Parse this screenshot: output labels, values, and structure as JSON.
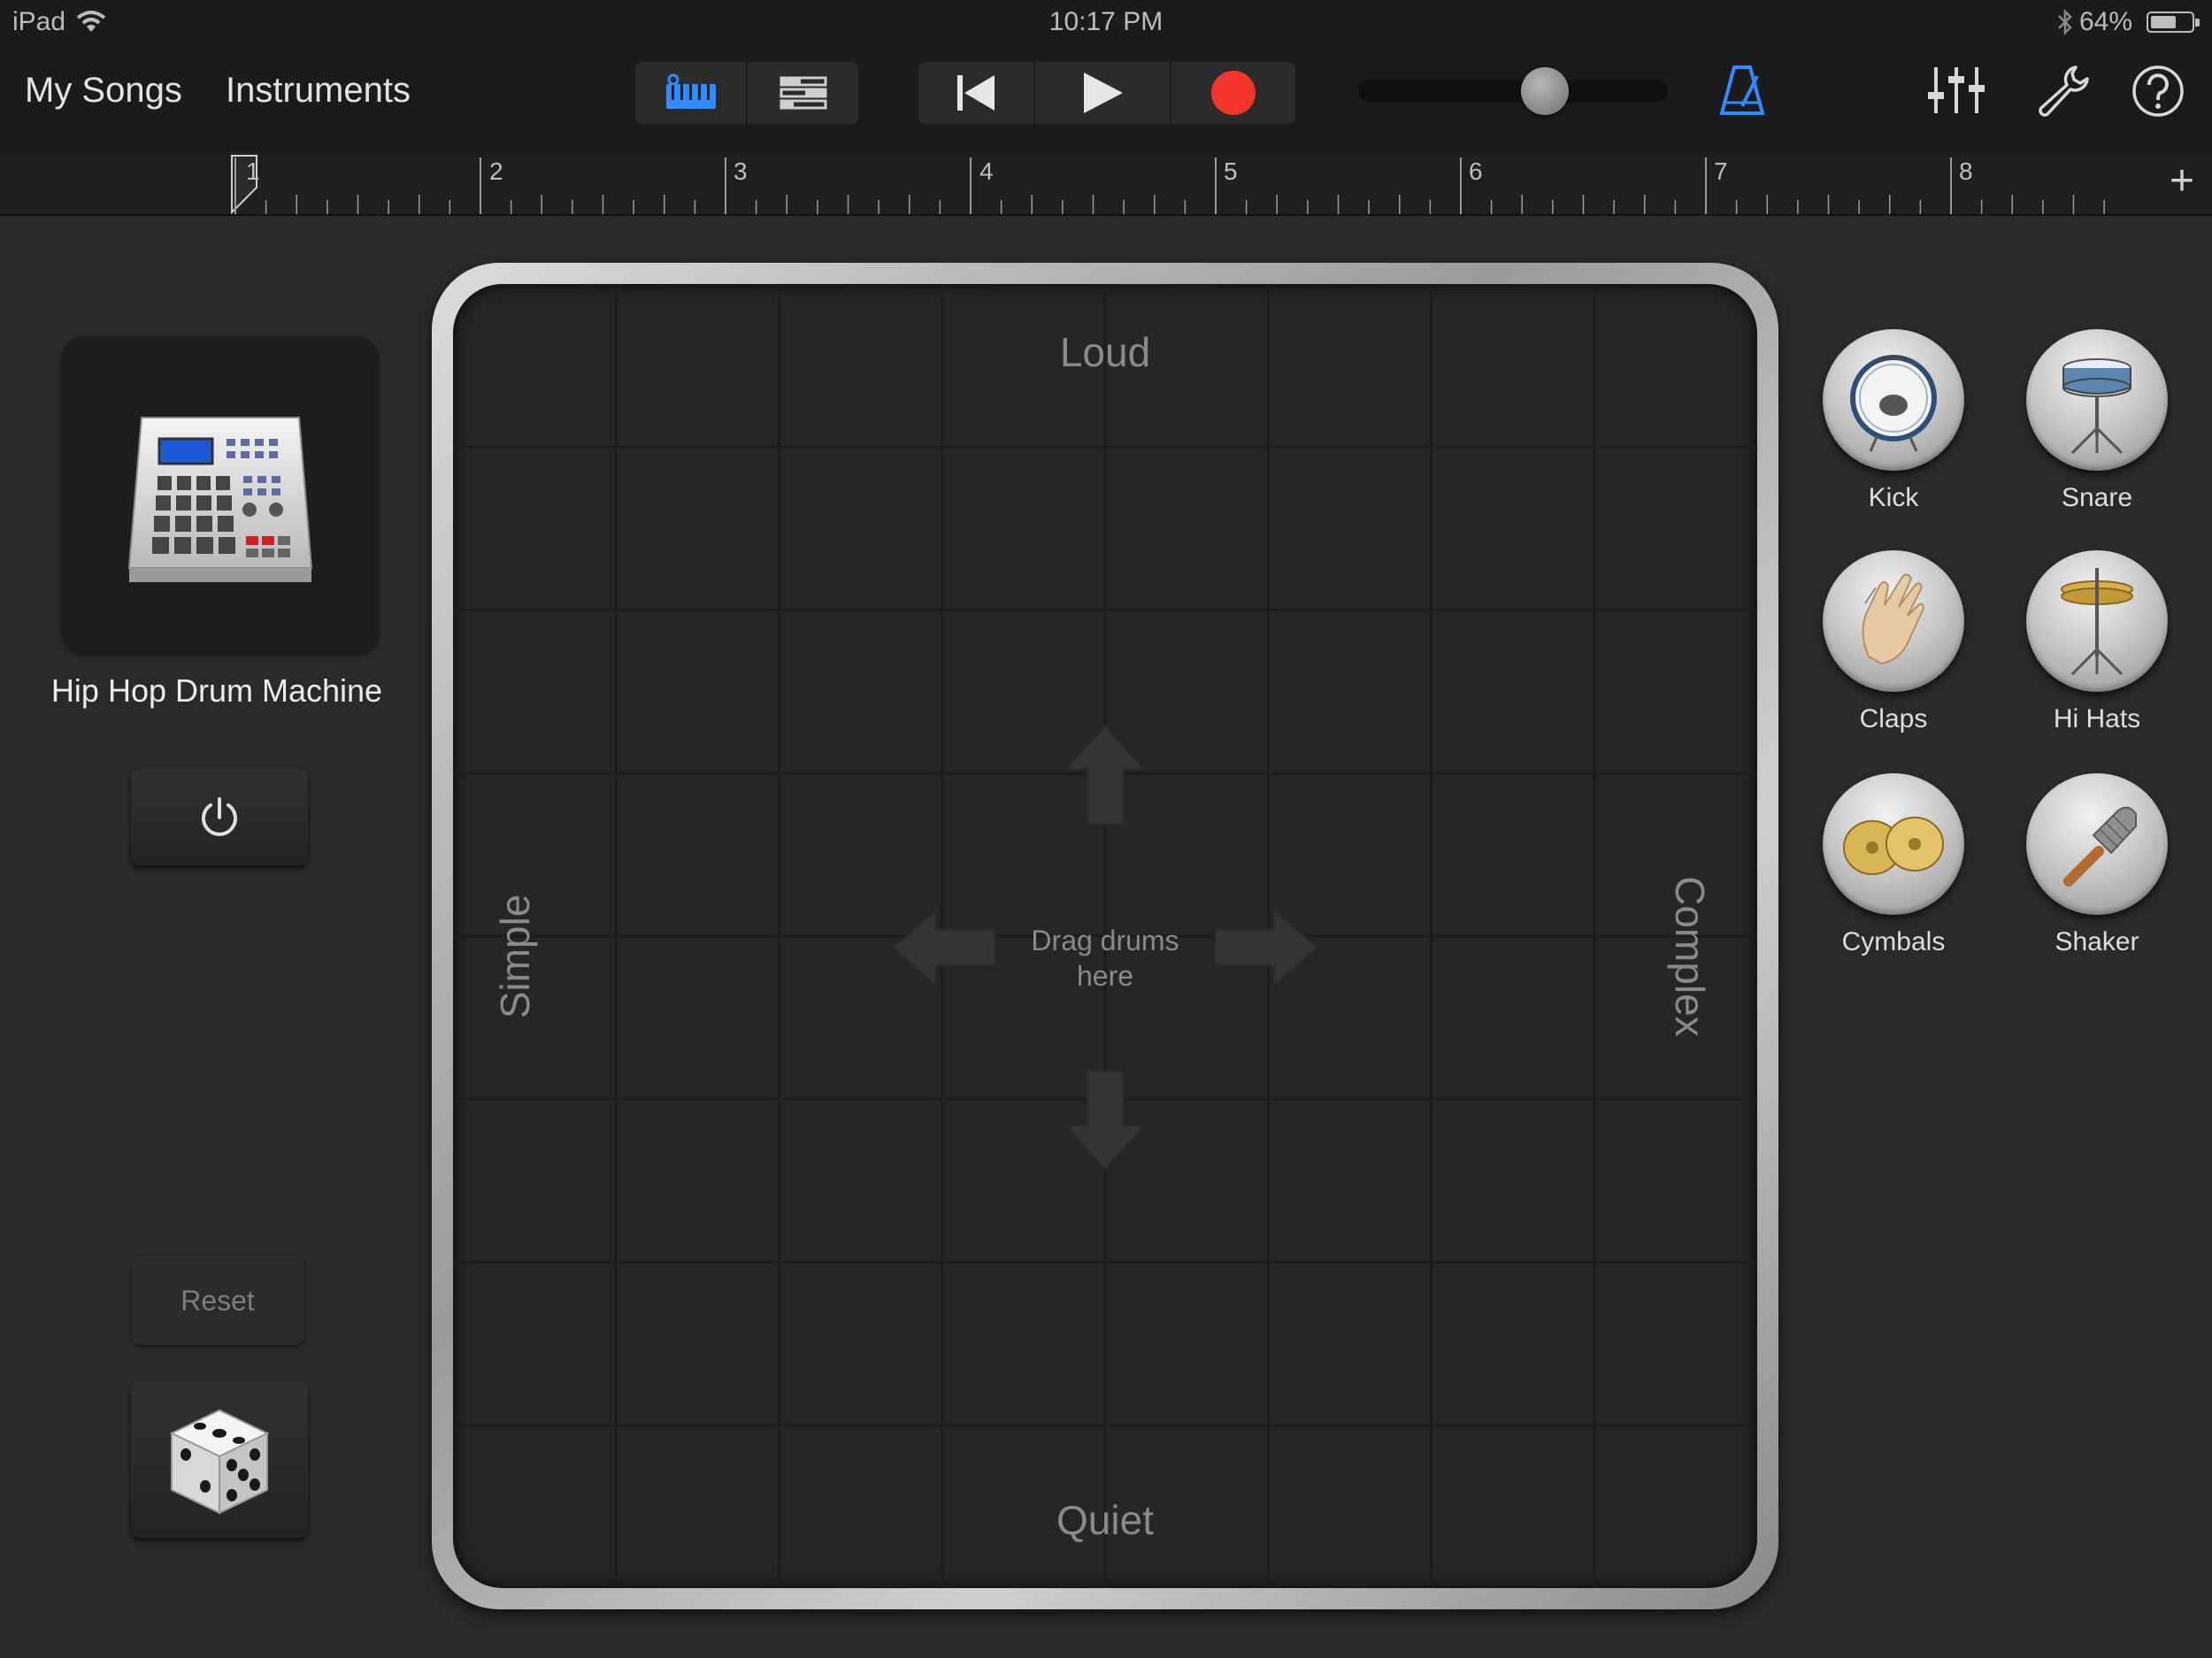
{
  "status_bar": {
    "device": "iPad",
    "time": "10:17 PM",
    "battery_percent": "64%",
    "battery_level": 0.64
  },
  "toolbar": {
    "my_songs": "My Songs",
    "instruments": "Instruments",
    "view_modes": [
      "instrument-view-icon",
      "tracks-view-icon"
    ],
    "active_view": "instrument-view-icon",
    "transport": [
      "go-to-beginning-icon",
      "play-icon",
      "record-icon"
    ],
    "volume_level": 0.62,
    "tools": [
      "metronome-icon",
      "mixer-icon",
      "settings-wrench-icon",
      "help-icon"
    ],
    "accent_color": "#2f8cff",
    "record_color": "#f2342a"
  },
  "ruler": {
    "bars": [
      "1",
      "2",
      "3",
      "4",
      "5",
      "6",
      "7",
      "8"
    ],
    "add_label": "+"
  },
  "instrument": {
    "name": "Hip Hop Drum Machine",
    "icon": "drum-machine-icon",
    "power_icon": "power-icon"
  },
  "controls": {
    "reset_label": "Reset",
    "random_icon": "dice-icon"
  },
  "pad": {
    "top_label": "Loud",
    "bottom_label": "Quiet",
    "left_label": "Simple",
    "right_label": "Complex",
    "hint_line1": "Drag drums",
    "hint_line2": "here"
  },
  "drums": [
    {
      "label": "Kick",
      "icon": "kick-drum-icon"
    },
    {
      "label": "Snare",
      "icon": "snare-drum-icon"
    },
    {
      "label": "Claps",
      "icon": "clap-hand-icon"
    },
    {
      "label": "Hi Hats",
      "icon": "hi-hat-icon"
    },
    {
      "label": "Cymbals",
      "icon": "cymbals-icon"
    },
    {
      "label": "Shaker",
      "icon": "shaker-icon"
    }
  ]
}
